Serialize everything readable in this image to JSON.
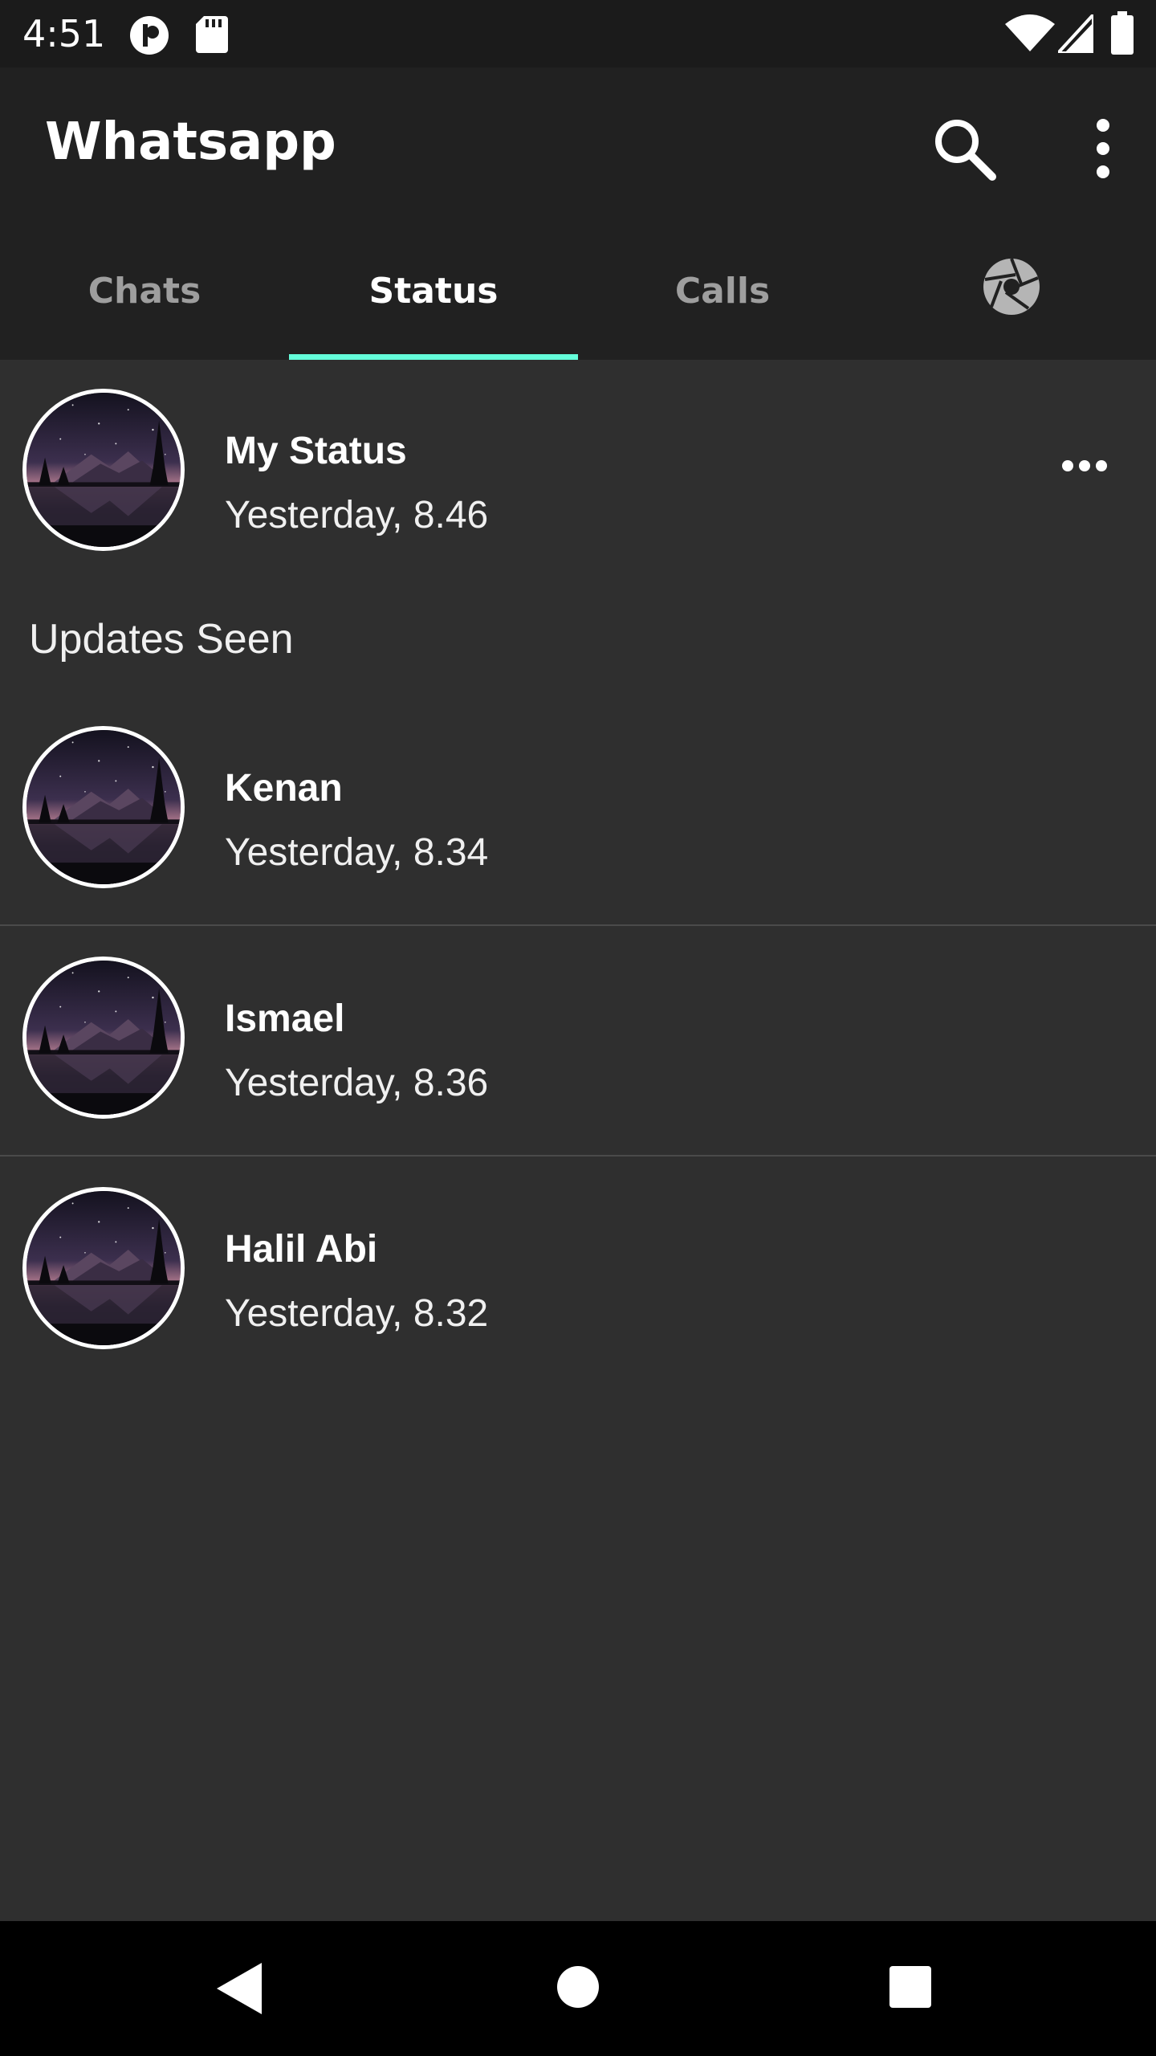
{
  "status_bar": {
    "time": "4:51",
    "icons": [
      "app-notification-icon",
      "sd-card-icon",
      "wifi-icon",
      "cell-signal-icon",
      "battery-icon"
    ]
  },
  "app_bar": {
    "title": "Whatsapp",
    "actions": [
      "search-icon",
      "more-vert-icon"
    ]
  },
  "tabs": [
    {
      "label": "Chats",
      "active": false
    },
    {
      "label": "Status",
      "active": true
    },
    {
      "label": "Calls",
      "active": false
    },
    {
      "icon": "camera-aperture-icon",
      "active": false
    }
  ],
  "my_status": {
    "name": "My Status",
    "time": "Yesterday, 8.46",
    "menu_icon": "more-horiz-icon"
  },
  "section_label": "Updates Seen",
  "updates": [
    {
      "name": "Kenan",
      "time": "Yesterday, 8.34"
    },
    {
      "name": "Ismael",
      "time": "Yesterday, 8.36"
    },
    {
      "name": "Halil Abi",
      "time": "Yesterday, 8.32"
    }
  ],
  "nav_bar": {
    "buttons": [
      "back-icon",
      "home-icon",
      "recents-icon"
    ]
  },
  "colors": {
    "background": "#2f2f2f",
    "app_bar": "#212121",
    "status_bar": "#1b1b1b",
    "tab_indicator": "#64ffda",
    "inactive_tab": "#9e9e9e"
  }
}
